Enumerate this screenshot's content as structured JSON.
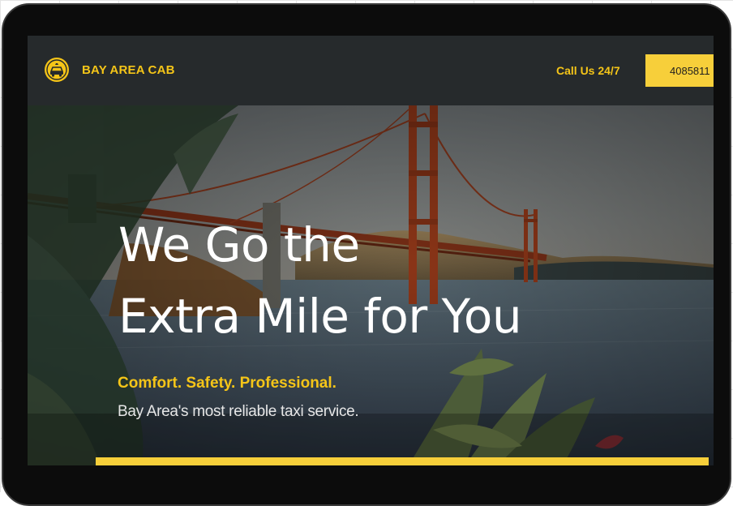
{
  "header": {
    "brand_name": "BAY AREA CAB",
    "logo_icon": "taxi-logo-icon",
    "call_label": "Call Us 24/7",
    "phone_button_label": "4085811"
  },
  "hero": {
    "headline_line1": "We Go the",
    "headline_line2": "Extra Mile for You",
    "tagline": "Comfort. Safety. Professional.",
    "subtitle": "Bay Area's most reliable taxi service.",
    "background": "golden-gate-bridge-photo"
  },
  "colors": {
    "accent": "#f5c518",
    "button": "#f7cf3a",
    "header_bg": "#262a2c",
    "device_frame": "#0c0c0c"
  }
}
